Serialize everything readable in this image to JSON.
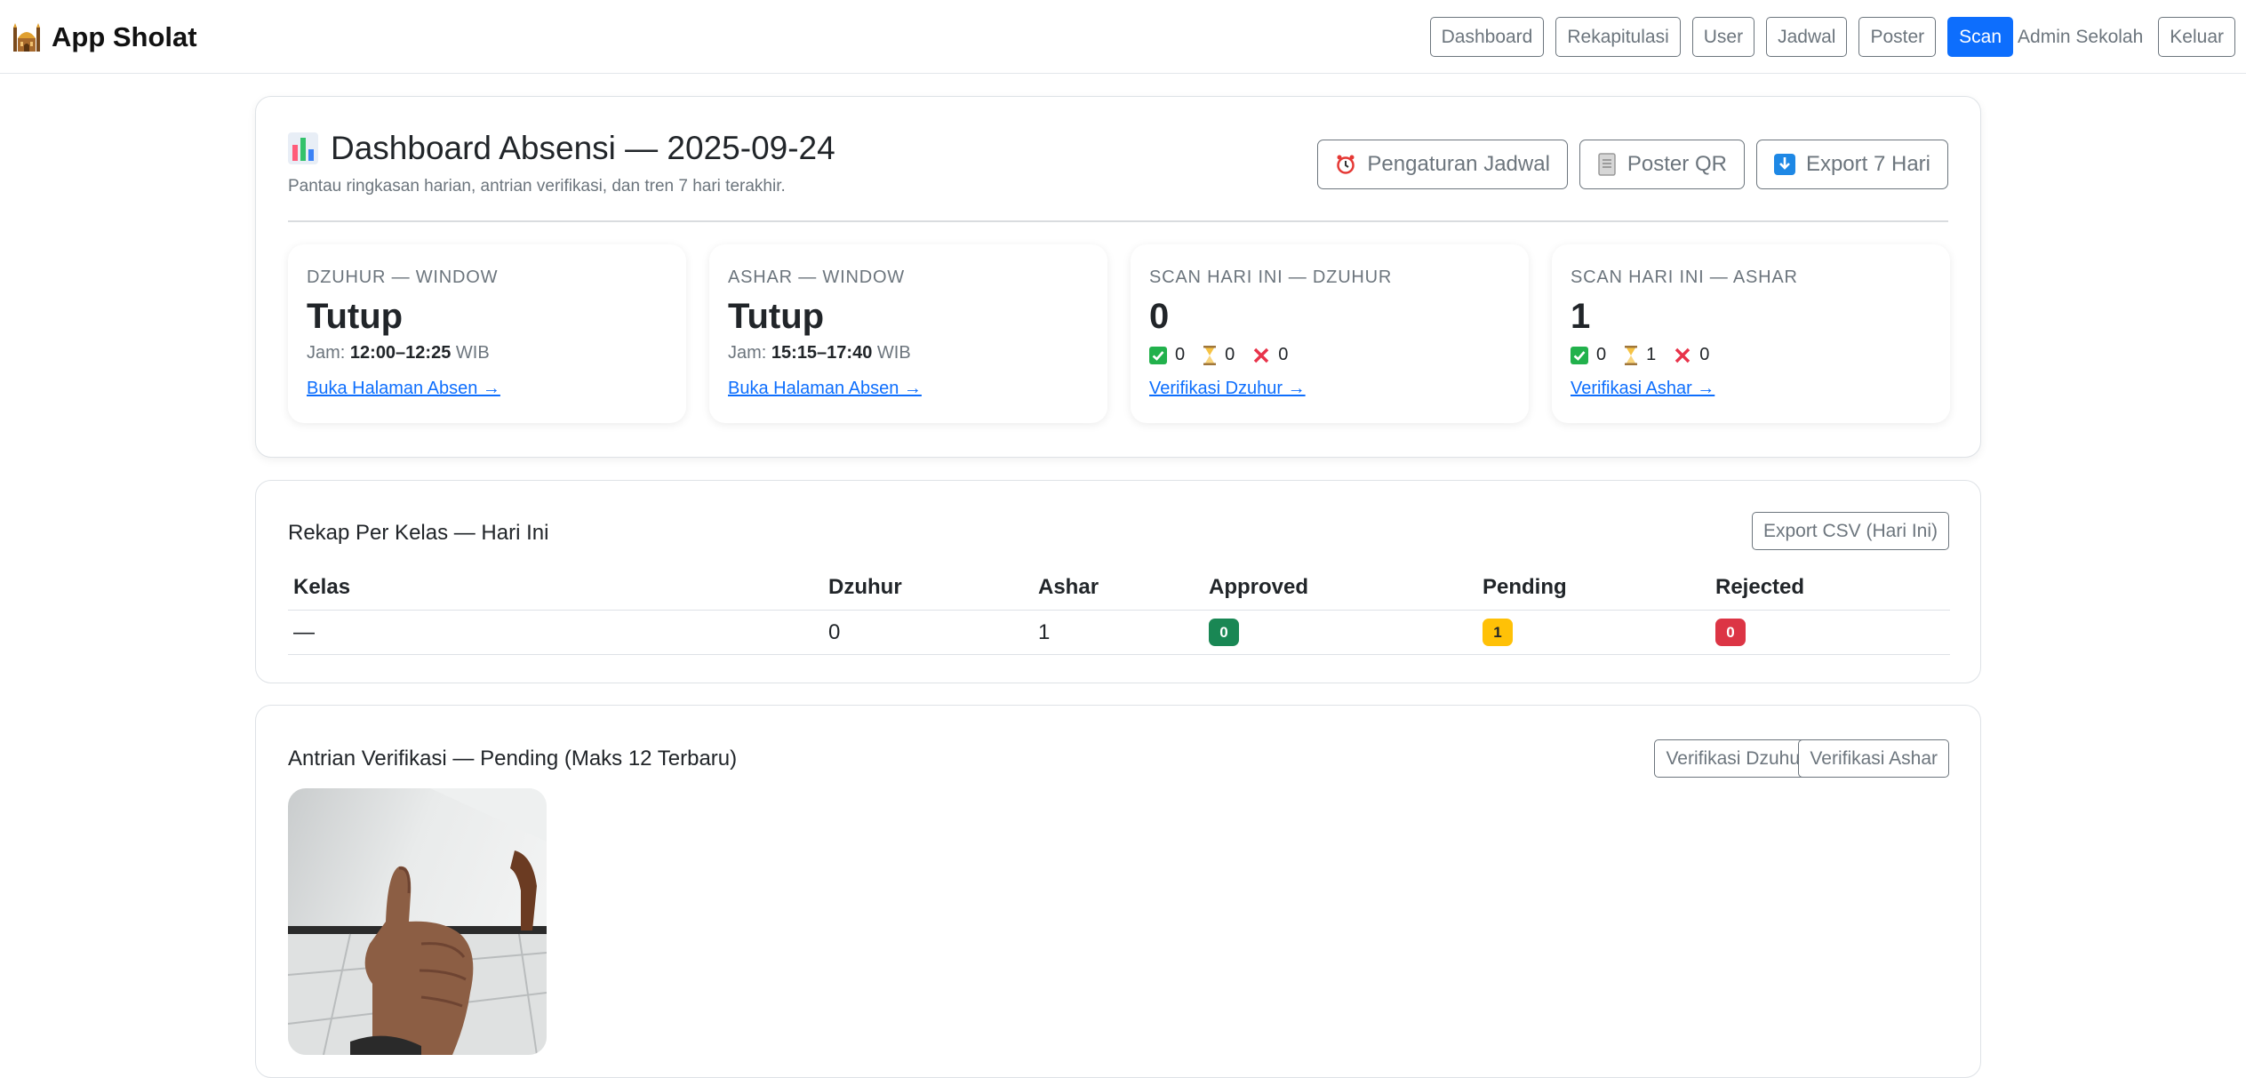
{
  "brand": {
    "title": "App Sholat",
    "icon": "mosque-icon"
  },
  "nav": {
    "items": [
      {
        "label": "Dashboard"
      },
      {
        "label": "Rekapitulasi"
      },
      {
        "label": "User"
      },
      {
        "label": "Jadwal"
      },
      {
        "label": "Poster"
      }
    ],
    "scan_label": "Scan",
    "user_label": "Admin Sekolah",
    "logout_label": "Keluar"
  },
  "dashboard": {
    "title": "Dashboard Absensi — 2025-09-24",
    "subtitle": "Pantau ringkasan harian, antrian verifikasi, dan tren 7 hari terakhir.",
    "actions": {
      "jadwal": "Pengaturan Jadwal",
      "poster": "Poster QR",
      "export": "Export 7 Hari"
    },
    "stats": [
      {
        "label": "DZUHUR — WINDOW",
        "value": "Tutup",
        "time_prefix": "Jam:",
        "time": "12:00–12:25",
        "tz": "WIB",
        "link": "Buka Halaman Absen →"
      },
      {
        "label": "ASHAR — WINDOW",
        "value": "Tutup",
        "time_prefix": "Jam:",
        "time": "15:15–17:40",
        "tz": "WIB",
        "link": "Buka Halaman Absen →"
      },
      {
        "label": "SCAN HARI INI — DZUHUR",
        "value": "0",
        "approved": "0",
        "pending": "0",
        "rejected": "0",
        "link": "Verifikasi Dzuhur →"
      },
      {
        "label": "SCAN HARI INI — ASHAR",
        "value": "1",
        "approved": "0",
        "pending": "1",
        "rejected": "0",
        "link": "Verifikasi Ashar →"
      }
    ]
  },
  "rekap": {
    "title": "Rekap Per Kelas — Hari Ini",
    "export_label": "Export CSV (Hari Ini)",
    "columns": [
      "Kelas",
      "Dzuhur",
      "Ashar",
      "Approved",
      "Pending",
      "Rejected"
    ],
    "rows": [
      {
        "kelas": "—",
        "dzuhur": "0",
        "ashar": "1",
        "approved": "0",
        "pending": "1",
        "rejected": "0"
      }
    ]
  },
  "antrian": {
    "title": "Antrian Verifikasi — Pending (Maks 12 Terbaru)",
    "btn_dzuhur": "Verifikasi Dzuhur",
    "btn_ashar": "Verifikasi Ashar"
  },
  "colors": {
    "primary": "#0d6efd",
    "approved": "#198754",
    "pending": "#ffc107",
    "rejected": "#dc3545",
    "muted": "#6c757d"
  }
}
